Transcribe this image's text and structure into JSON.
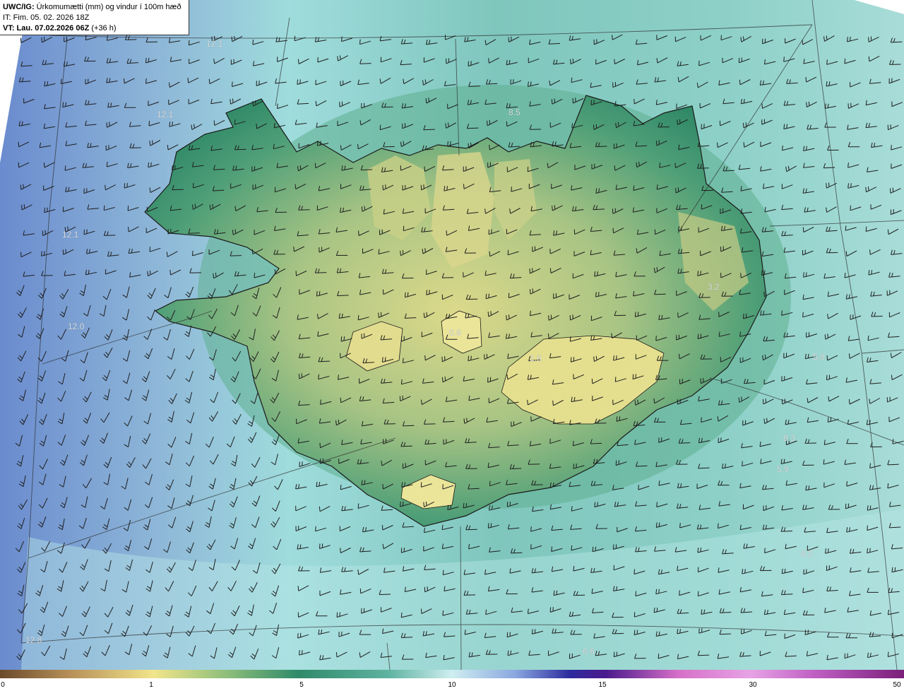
{
  "header": {
    "prefix": "UWC/IG:",
    "title": " Úrkomumætti (mm) og vindur í 100m hæð",
    "it_line": "IT: Fim. 05. 02. 2026 18Z",
    "vt_label": "VT: Lau. 07.02.2026 06Z",
    "vt_lead": " (+36 h)"
  },
  "colorbar": {
    "ticks": [
      "0",
      "1",
      "5",
      "10",
      "15",
      "30",
      "50"
    ]
  },
  "map_labels": [
    "12.1",
    "12.1",
    "8.5",
    "12.1",
    "3.2",
    "12.0",
    "0.9",
    "1.8",
    "5.8",
    "8.3",
    "5.9",
    "6.2",
    "6.6",
    "12.8"
  ],
  "colors": {
    "sea_deep": "#6e8fce",
    "sea_mid": "#7fc2c0",
    "sea_light": "#bfe8ea",
    "land_high": "#d8d98a",
    "land_mid": "#3f9a74",
    "coast": "#1a1a1a",
    "barb": "#1e1e1e"
  }
}
